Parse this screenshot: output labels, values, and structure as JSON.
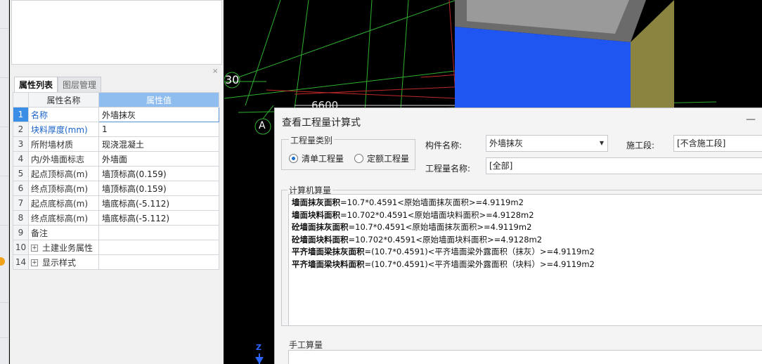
{
  "property_panel": {
    "tabs": [
      {
        "label": "属性列表"
      },
      {
        "label": "图层管理"
      }
    ],
    "headers": {
      "name": "属性名称",
      "value": "属性值"
    },
    "rows": [
      {
        "num": "1",
        "name": "名称",
        "value": "外墙抹灰"
      },
      {
        "num": "2",
        "name": "块料厚度(mm)",
        "value": "1"
      },
      {
        "num": "3",
        "name": "所附墙材质",
        "value": "现浇混凝土"
      },
      {
        "num": "4",
        "name": "内/外墙面标志",
        "value": "外墙面"
      },
      {
        "num": "5",
        "name": "起点顶标高(m)",
        "value": "墙顶标高(0.159)"
      },
      {
        "num": "6",
        "name": "终点顶标高(m)",
        "value": "墙顶标高(0.159)"
      },
      {
        "num": "7",
        "name": "起点底标高(m)",
        "value": "墙底标高(-5.112)"
      },
      {
        "num": "8",
        "name": "终点底标高(m)",
        "value": "墙底标高(-5.112)"
      },
      {
        "num": "9",
        "name": "备注",
        "value": ""
      },
      {
        "num": "10",
        "name": "土建业务属性",
        "value": ""
      },
      {
        "num": "14",
        "name": "显示样式",
        "value": ""
      }
    ],
    "close_glyph": "×",
    "expand_glyph": "+"
  },
  "viewport": {
    "axis_number": "30",
    "axis_letter": "A",
    "dimension": "6600",
    "z_label": "Z"
  },
  "dialog": {
    "title": "查看工程量计算式",
    "minimize_glyph": "—",
    "quantity_type": {
      "legend": "工程量类别",
      "options": [
        {
          "label": "清单工程量",
          "selected": true
        },
        {
          "label": "定额工程量",
          "selected": false
        }
      ]
    },
    "component_name": {
      "label": "构件名称:",
      "value": "外墙抹灰"
    },
    "construction_stage": {
      "label": "施工段:",
      "value": "[不含施工段]"
    },
    "quantity_name": {
      "label": "工程量名称:",
      "value": "[全部]"
    },
    "computer_calc": {
      "legend": "计算机算量",
      "lines": [
        {
          "term": "墙面抹灰面积",
          "expr": "=10.7*0.4591<原始墙面抹灰面积>=4.9119m2"
        },
        {
          "term": "墙面块料面积",
          "expr": "=10.702*0.4591<原始墙面块料面积>=4.9128m2"
        },
        {
          "term": "砼墙面抹灰面积",
          "expr": "=10.7*0.4591<原始墙面抹灰面积>=4.9119m2"
        },
        {
          "term": "砼墙面块料面积",
          "expr": "=10.702*0.4591<原始墙面块料面积>=4.9128m2"
        },
        {
          "term": "平齐墙面梁抹灰面积",
          "expr": "=(10.7*0.4591)<平齐墙面梁外露面积（抹灰）>=4.9119m2"
        },
        {
          "term": "平齐墙面梁块料面积",
          "expr": "=(10.7*0.4591)<平齐墙面梁外露面积（块料）>=4.9119m2"
        }
      ]
    },
    "manual_calc": {
      "legend": "手工算量"
    }
  },
  "colors": {
    "selection_blue": "#3a8ee6",
    "header_value_blue": "#8fbdf0",
    "arrow_red": "#e8302a",
    "wall_blue": "#1f55f0",
    "wall_olive": "#8a8440",
    "grid_green": "#2fb02f",
    "grid_red": "#c0282a"
  }
}
